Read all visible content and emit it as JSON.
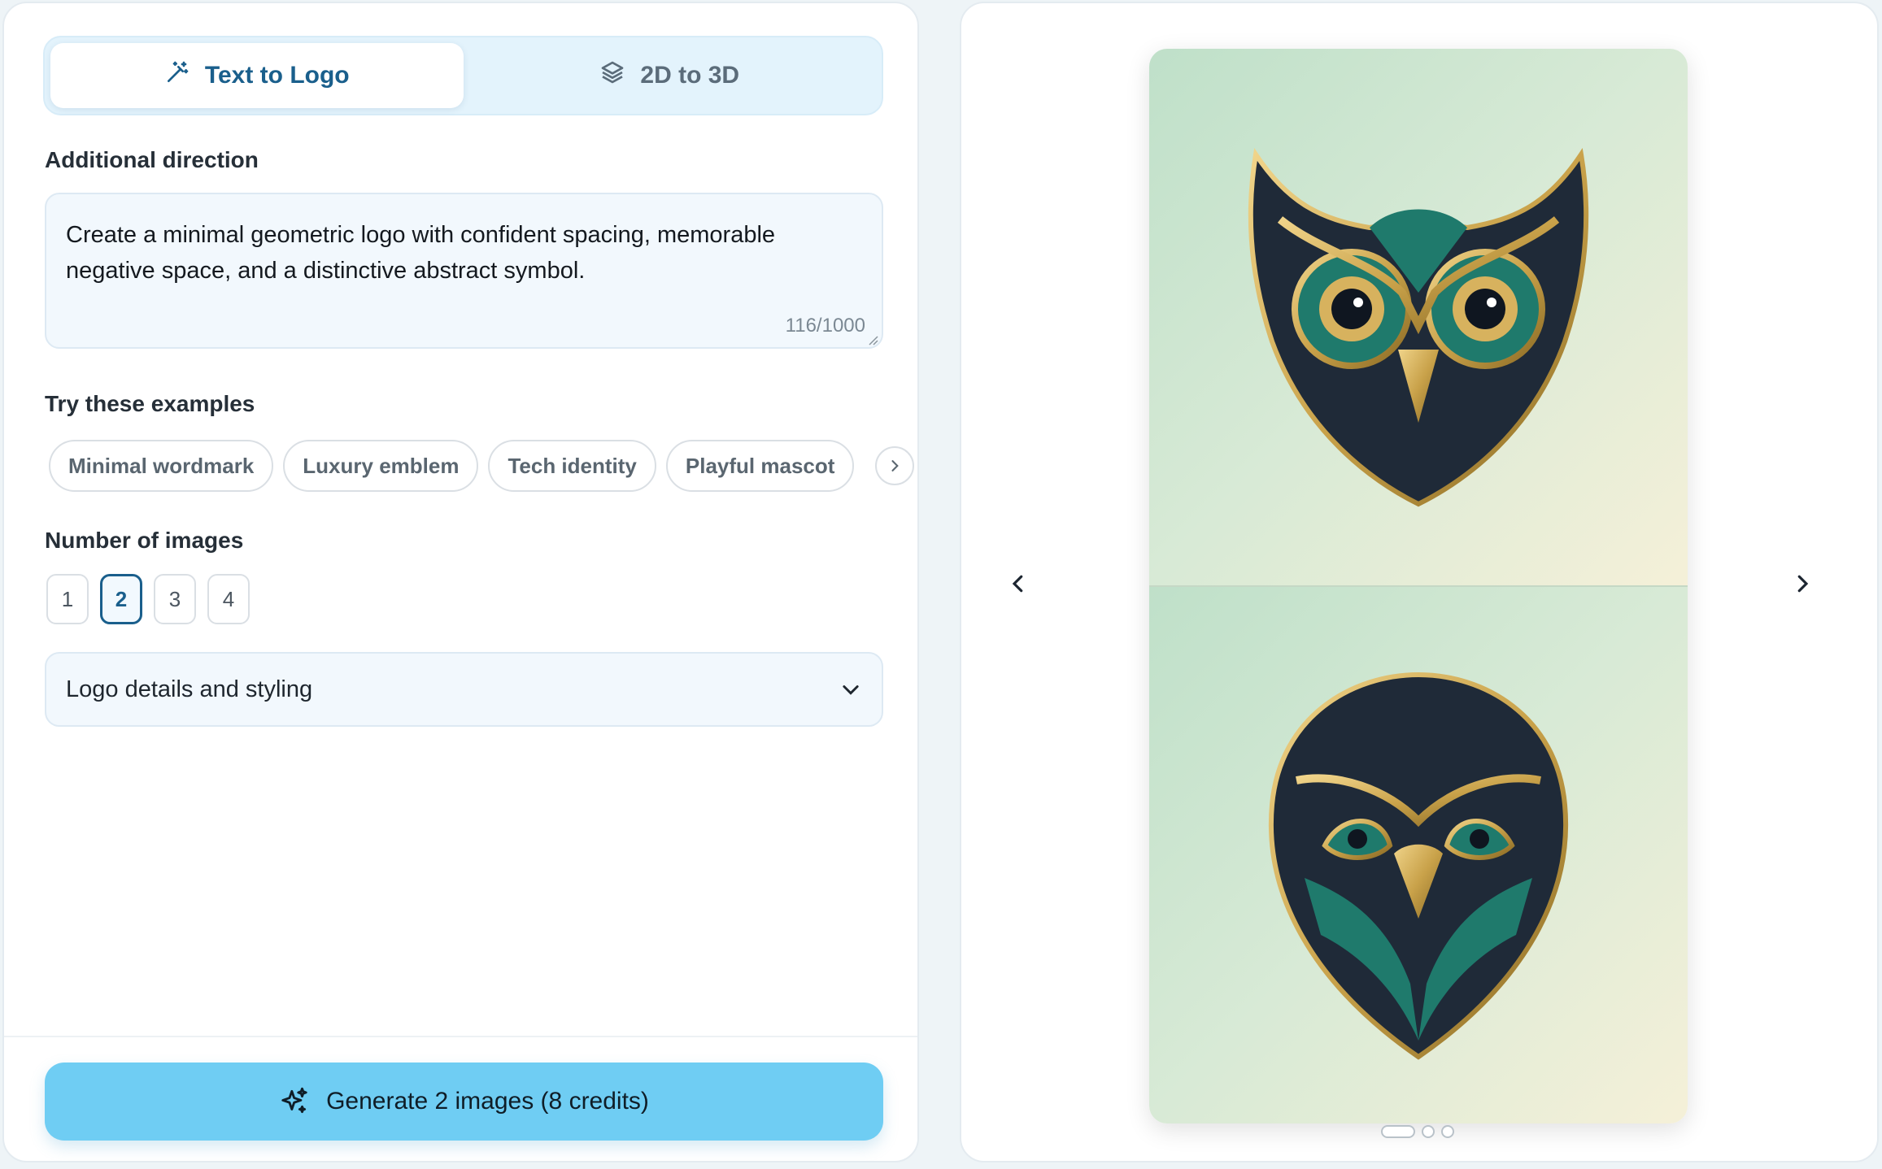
{
  "tabs": [
    {
      "label": "Text to Logo",
      "icon": "magic-wand-icon",
      "active": true
    },
    {
      "label": "2D to 3D",
      "icon": "layers-icon",
      "active": false
    }
  ],
  "direction": {
    "label": "Additional direction",
    "value": "Create a minimal geometric logo with confident spacing, memorable negative space, and a distinctive abstract symbol.",
    "counter": "116/1000"
  },
  "examples": {
    "label": "Try these examples",
    "chips": [
      "Minimal wordmark",
      "Luxury emblem",
      "Tech identity",
      "Playful mascot"
    ]
  },
  "image_count": {
    "label": "Number of images",
    "options": [
      "1",
      "2",
      "3",
      "4"
    ],
    "selected": "2"
  },
  "details": {
    "label": "Logo details and styling"
  },
  "generate": {
    "label": "Generate 2 images (8 credits)"
  },
  "preview": {
    "slides": 3,
    "active_slide": 1,
    "colors": {
      "teal": "#1f7a6c",
      "navy": "#1f2a38",
      "gold": "#c9a24a"
    }
  }
}
